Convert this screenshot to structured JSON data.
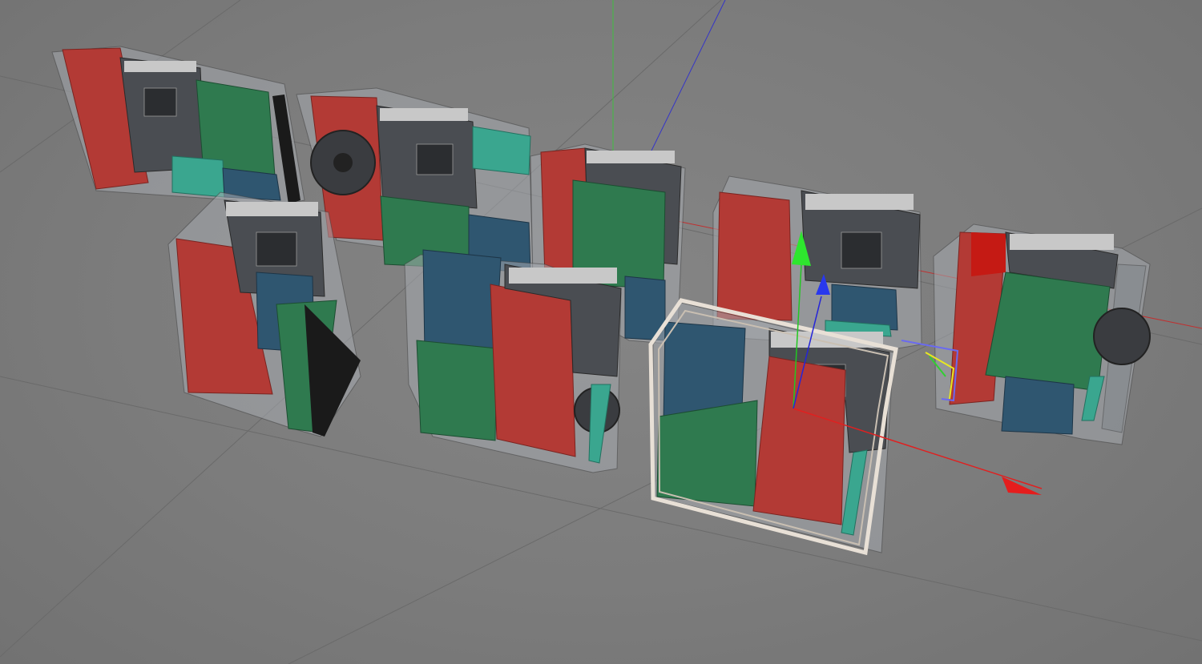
{
  "viewport": {
    "background": "#7a7a7a",
    "axis_colors": {
      "x": "#e02020",
      "y": "#22dd22",
      "z": "#2020e0"
    },
    "selected_object": "pc-case-7"
  },
  "colors": {
    "psu": "#b33a35",
    "gpu": "#2f7a4f",
    "drive": "#2f5670",
    "ram": "#3aa68f"
  },
  "icons": {
    "move_x": "move-x-arrow-icon",
    "move_y": "move-y-arrow-icon",
    "move_z": "move-z-arrow-icon"
  }
}
